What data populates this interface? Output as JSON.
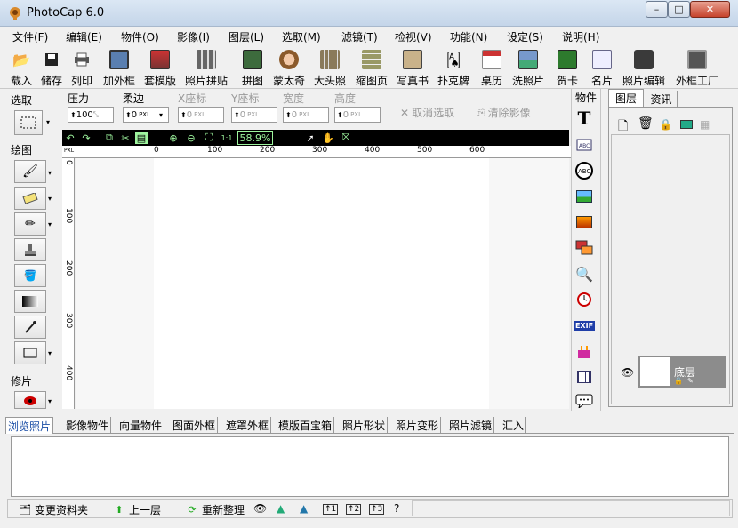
{
  "window": {
    "title": "PhotoCap 6.0",
    "minimize": "–",
    "maximize": "□",
    "close": "✕"
  },
  "menu": [
    "文件(F)",
    "编辑(E)",
    "物件(O)",
    "影像(I)",
    "图层(L)",
    "选取(M)",
    "滤镜(T)",
    "检视(V)",
    "功能(N)",
    "设定(S)",
    "说明(H)"
  ],
  "toolbar": [
    {
      "label": "载入",
      "icon": "folder-open-icon"
    },
    {
      "label": "储存",
      "icon": "save-icon"
    },
    {
      "label": "列印",
      "icon": "printer-icon"
    },
    {
      "label": "加外框",
      "icon": "frame-icon"
    },
    {
      "label": "套模版",
      "icon": "template-icon"
    },
    {
      "label": "照片拼贴",
      "icon": "collage-icon"
    },
    {
      "label": "拼图",
      "icon": "puzzle-icon"
    },
    {
      "label": "蒙太奇",
      "icon": "montage-icon"
    },
    {
      "label": "大头照",
      "icon": "id-photo-icon"
    },
    {
      "label": "缩图页",
      "icon": "thumbnail-page-icon"
    },
    {
      "label": "写真书",
      "icon": "photo-book-icon"
    },
    {
      "label": "扑克牌",
      "icon": "cards-icon"
    },
    {
      "label": "桌历",
      "icon": "calendar-icon"
    },
    {
      "label": "洗照片",
      "icon": "print-photo-icon"
    },
    {
      "label": "贺卡",
      "icon": "greeting-card-icon"
    },
    {
      "label": "名片",
      "icon": "business-card-icon"
    },
    {
      "label": "照片编辑",
      "icon": "photo-edit-icon"
    },
    {
      "label": "外框工厂",
      "icon": "frame-factory-icon"
    }
  ],
  "options": {
    "pressure_label": "压力",
    "pressure_value": "100",
    "feather_label": "柔边",
    "feather_value": "0",
    "x_label": "X座标",
    "x_value": "0",
    "y_label": "Y座标",
    "y_value": "0",
    "width_label": "宽度",
    "width_value": "0",
    "height_label": "高度",
    "height_value": "0",
    "unit": "PXL",
    "cancel_select": "取消选取",
    "clear_image": "清除影像"
  },
  "left_panel": {
    "select_label": "选取",
    "draw_label": "绘图",
    "retouch_label": "修片"
  },
  "canvas": {
    "zoom": "58.9%",
    "unit": "PXL"
  },
  "ruler_h_ticks": [
    "0",
    "100",
    "200",
    "300",
    "400",
    "500",
    "600"
  ],
  "ruler_v_ticks": [
    "0",
    "100",
    "200",
    "300",
    "400"
  ],
  "objects_label": "物件",
  "layers_panel": {
    "tab_layers": "图层",
    "tab_info": "资讯",
    "layer_name": "底层"
  },
  "bottom_tabs": [
    "浏览照片",
    "影像物件",
    "向量物件",
    "图面外框",
    "遮罩外框",
    "模版百宝箱",
    "照片形状",
    "照片变形",
    "照片滤镜",
    "汇入"
  ],
  "statusbar": {
    "change_folder": "变更资料夹",
    "up_level": "上一层",
    "reorganize": "重新整理",
    "help": "?"
  },
  "colors": {
    "accent_blue": "#1b4ea6",
    "canvas_bar": "#000000",
    "zoom_green": "#9ef59e",
    "layer_selected": "#8c8c8c"
  }
}
